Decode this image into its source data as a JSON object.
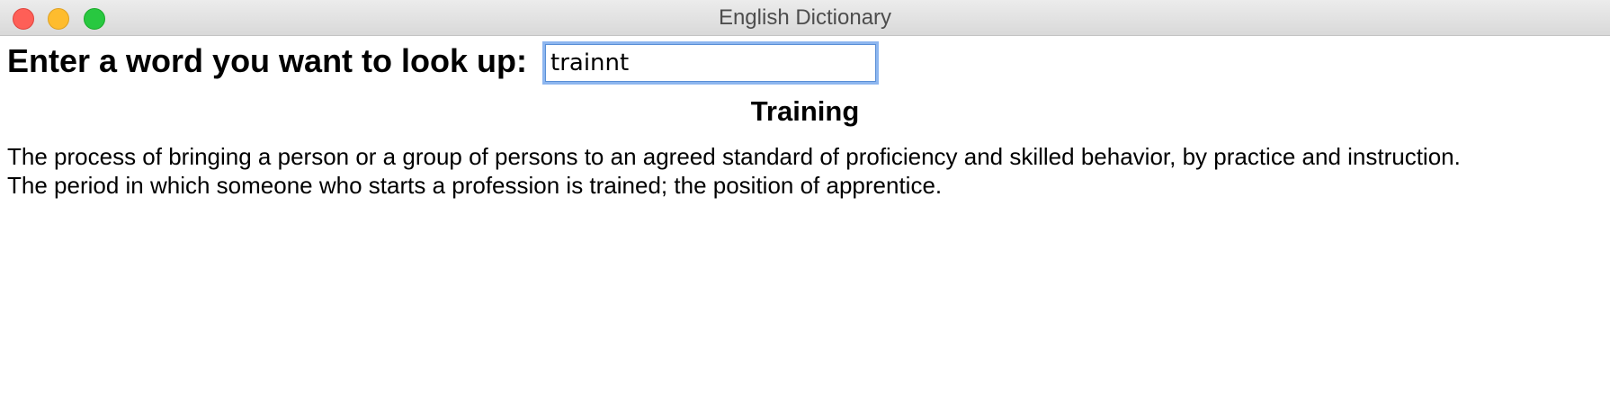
{
  "window": {
    "title": "English Dictionary"
  },
  "lookup": {
    "prompt_label": "Enter a word you want to look up:",
    "input_value": "trainnt"
  },
  "result": {
    "title": "Training",
    "definitions": [
      "The process of bringing a person or a group of persons to an agreed standard of proficiency and skilled behavior, by practice and instruction.",
      "The period in which someone who starts a profession is trained; the position of apprentice."
    ]
  }
}
